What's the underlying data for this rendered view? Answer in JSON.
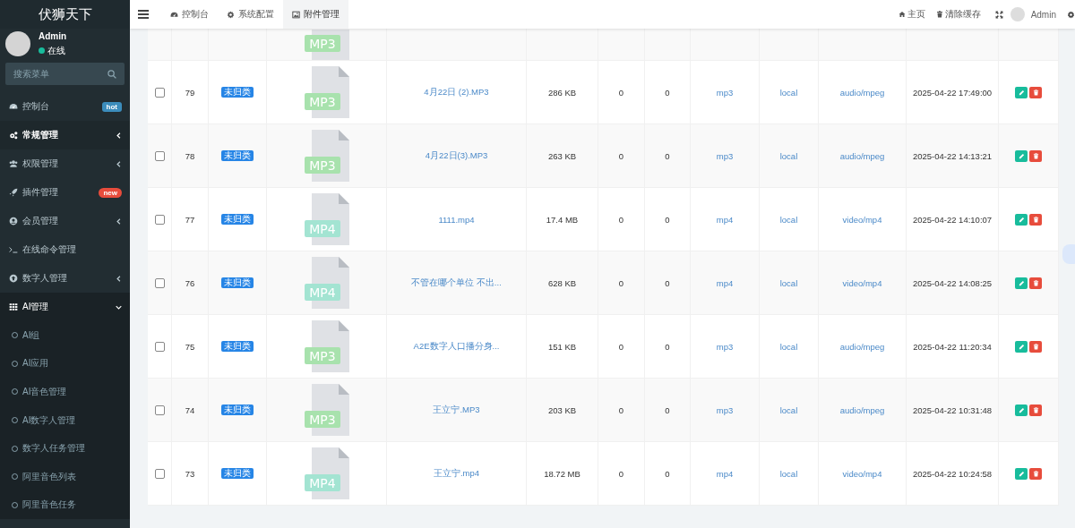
{
  "sidebar": {
    "logo": "伏狮天下",
    "user": {
      "name": "Admin",
      "status": "在线",
      "online": true
    },
    "search": {
      "placeholder": "搜索菜单"
    },
    "menu": [
      {
        "label": "控制台",
        "badge": {
          "text": "hot",
          "color": "#3c8dbc"
        },
        "selected": false
      },
      {
        "label": "常规管理",
        "expanded": false,
        "selected": true
      },
      {
        "label": "权限管理",
        "expanded": false,
        "selected": false
      },
      {
        "label": "插件管理",
        "badge": {
          "text": "new",
          "color": "#e74c3c"
        },
        "selected": false
      },
      {
        "label": "会员管理",
        "expanded": false,
        "selected": false
      },
      {
        "label": "在线命令管理",
        "selected": false
      },
      {
        "label": "数字人管理",
        "expanded": false,
        "selected": false
      },
      {
        "label": "AI管理",
        "expanded": true,
        "selected": false,
        "children": [
          {
            "label": "AI组",
            "selected": false
          },
          {
            "label": "AI应用",
            "selected": false
          },
          {
            "label": "AI音色管理",
            "selected": false
          },
          {
            "label": "AI数字人管理",
            "selected": false
          },
          {
            "label": "数字人任务管理",
            "selected": false
          },
          {
            "label": "阿里音色列表",
            "selected": false
          },
          {
            "label": "阿里音色任务",
            "selected": false
          }
        ]
      }
    ]
  },
  "header": {
    "tabs": [
      {
        "label": "控制台",
        "selected": false
      },
      {
        "label": "系统配置",
        "selected": false
      },
      {
        "label": "附件管理",
        "selected": true
      }
    ],
    "links": [
      {
        "label": "主页"
      },
      {
        "label": "清除缓存"
      }
    ],
    "user": {
      "name": "Admin"
    }
  },
  "table": {
    "rows": [
      {
        "file": {
          "ext": "MP3",
          "color": "#a8e2ad"
        }
      },
      {
        "checked": false,
        "id": "79",
        "category": "未归类",
        "file": {
          "ext": "MP3",
          "color": "#a8e2ad"
        },
        "filename": "4月22日 (2).MP3",
        "size": "286 KB",
        "column_7": "0",
        "column_8": "0",
        "extension": "mp3",
        "storage": "local",
        "mimetype": "audio/mpeg",
        "date": "2025-04-22 17:49:00"
      },
      {
        "checked": false,
        "id": "78",
        "category": "未归类",
        "file": {
          "ext": "MP3",
          "color": "#a8e2ad"
        },
        "filename": "4月22日(3).MP3",
        "size": "263 KB",
        "column_7": "0",
        "column_8": "0",
        "extension": "mp3",
        "storage": "local",
        "mimetype": "audio/mpeg",
        "date": "2025-04-22 14:13:21"
      },
      {
        "checked": false,
        "id": "77",
        "category": "未归类",
        "file": {
          "ext": "MP4",
          "color": "#a3e4d2"
        },
        "filename": "1111.mp4",
        "size": "17.4 MB",
        "column_7": "0",
        "column_8": "0",
        "extension": "mp4",
        "storage": "local",
        "mimetype": "video/mp4",
        "date": "2025-04-22 14:10:07"
      },
      {
        "checked": false,
        "id": "76",
        "category": "未归类",
        "file": {
          "ext": "MP4",
          "color": "#a3e4d2"
        },
        "filename": "不管在哪个单位 不出...",
        "size": "628 KB",
        "column_7": "0",
        "column_8": "0",
        "extension": "mp4",
        "storage": "local",
        "mimetype": "video/mp4",
        "date": "2025-04-22 14:08:25"
      },
      {
        "checked": false,
        "id": "75",
        "category": "未归类",
        "file": {
          "ext": "MP3",
          "color": "#a8e2ad"
        },
        "filename": "A2E数字人口播分身...",
        "size": "151 KB",
        "column_7": "0",
        "column_8": "0",
        "extension": "mp3",
        "storage": "local",
        "mimetype": "audio/mpeg",
        "date": "2025-04-22 11:20:34"
      },
      {
        "checked": false,
        "id": "74",
        "category": "未归类",
        "file": {
          "ext": "MP3",
          "color": "#a8e2ad"
        },
        "filename": "王立宁.MP3",
        "size": "203 KB",
        "column_7": "0",
        "column_8": "0",
        "extension": "mp3",
        "storage": "local",
        "mimetype": "audio/mpeg",
        "date": "2025-04-22 10:31:48"
      },
      {
        "checked": false,
        "id": "73",
        "category": "未归类",
        "file": {
          "ext": "MP4",
          "color": "#a3e4d2"
        },
        "filename": "王立宁.mp4",
        "size": "18.72 MB",
        "column_7": "0",
        "column_8": "0",
        "extension": "mp4",
        "storage": "local",
        "mimetype": "video/mp4",
        "date": "2025-04-22 10:24:58"
      }
    ]
  }
}
